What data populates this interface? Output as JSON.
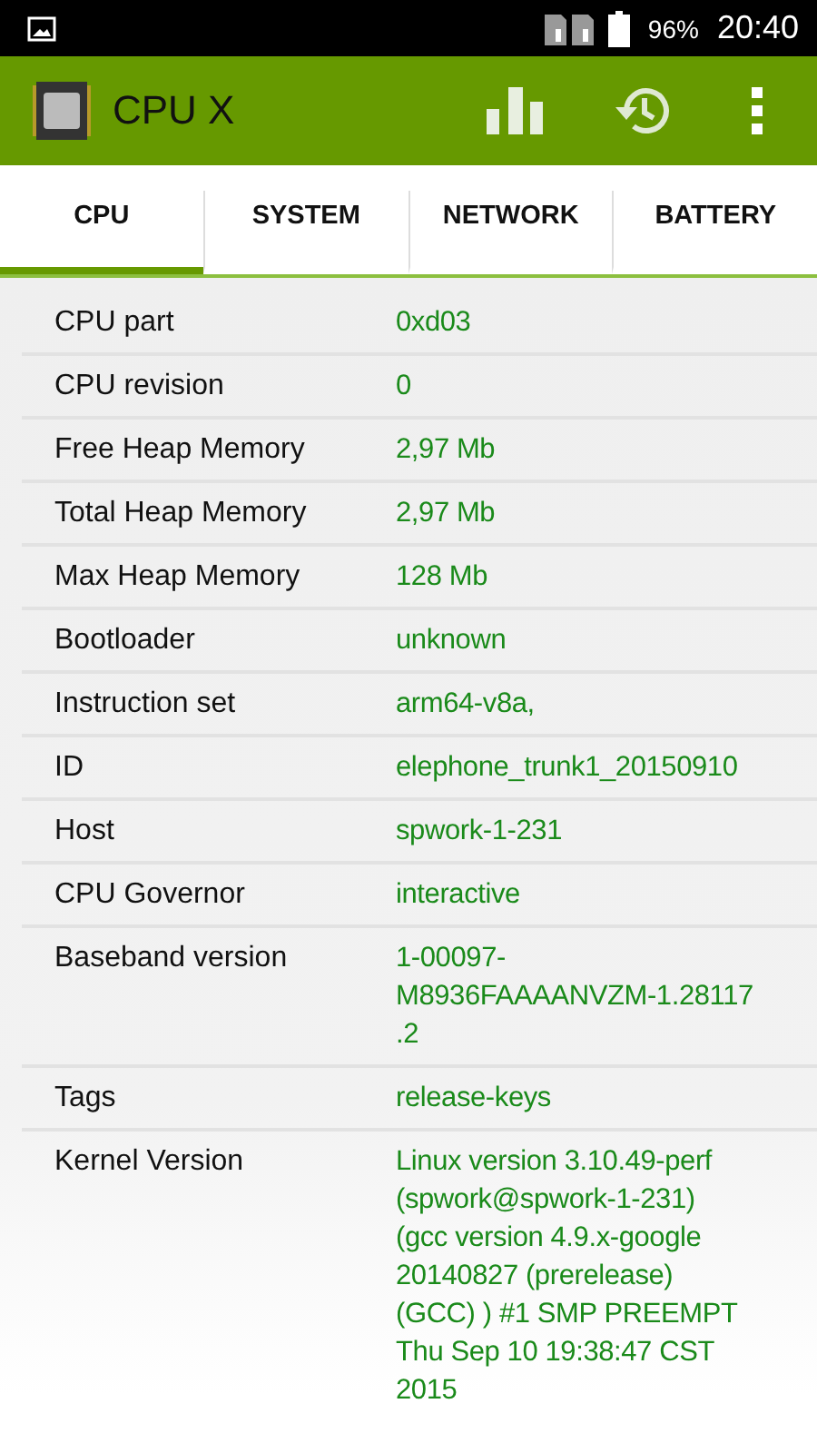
{
  "status_bar": {
    "battery": "96%",
    "time": "20:40"
  },
  "app_bar": {
    "title": "CPU X"
  },
  "tabs": [
    {
      "label": "CPU",
      "selected": true
    },
    {
      "label": "SYSTEM",
      "selected": false
    },
    {
      "label": "NETWORK",
      "selected": false
    },
    {
      "label": "BATTERY",
      "selected": false
    }
  ],
  "rows": [
    {
      "label": "CPU part",
      "value": "0xd03"
    },
    {
      "label": "CPU revision",
      "value": "0"
    },
    {
      "label": "Free Heap Memory",
      "value": "2,97 Mb"
    },
    {
      "label": "Total Heap Memory",
      "value": "2,97 Mb"
    },
    {
      "label": "Max Heap Memory",
      "value": "128 Mb"
    },
    {
      "label": "Bootloader",
      "value": "unknown"
    },
    {
      "label": "Instruction set",
      "value": "arm64-v8a,"
    },
    {
      "label": "ID",
      "value": "elephone_trunk1_20150910"
    },
    {
      "label": "Host",
      "value": "spwork-1-231"
    },
    {
      "label": "CPU Governor",
      "value": "interactive"
    },
    {
      "label": "Baseband version",
      "value": "1-00097-\nM8936FAAAANVZM-1.28117\n.2"
    },
    {
      "label": "Tags",
      "value": "release-keys"
    },
    {
      "label": "Kernel Version",
      "value": "Linux version 3.10.49-perf\n(spwork@spwork-1-231)\n(gcc version 4.9.x-google\n20140827 (prerelease)\n(GCC) ) #1 SMP PREEMPT\nThu Sep 10 19:38:47 CST\n2015"
    }
  ]
}
